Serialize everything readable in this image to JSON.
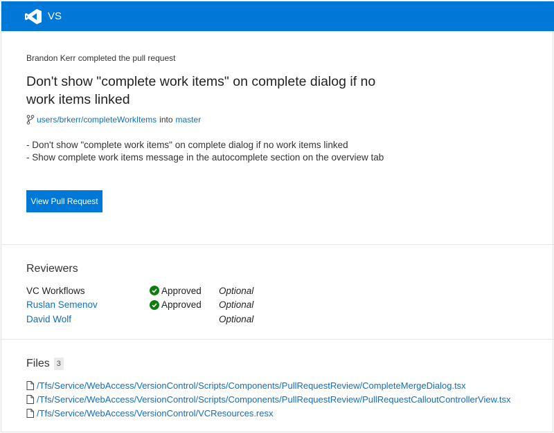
{
  "header": {
    "brand": "VS"
  },
  "pull_request": {
    "activity": "Brandon Kerr completed the pull request",
    "title": "Don't show \"complete work items\" on complete dialog if no work items linked",
    "source_branch": "users/brkerr/completeWorkItems",
    "into_text": "into",
    "target_branch": "master",
    "description_lines": [
      "- Don't show \"complete work items\" on complete dialog if no work items linked",
      "- Show complete work items message in the autocomplete section on the overview tab"
    ],
    "view_button_label": "View Pull Request"
  },
  "reviewers": {
    "heading": "Reviewers",
    "items": [
      {
        "name": "VC Workflows",
        "status": "Approved",
        "requirement": "Optional"
      },
      {
        "name": "Ruslan Semenov",
        "status": "Approved",
        "requirement": "Optional"
      },
      {
        "name": "David Wolf",
        "status": "",
        "requirement": "Optional"
      }
    ]
  },
  "files": {
    "heading": "Files",
    "count": "3",
    "items": [
      "/Tfs/Service/WebAccess/VersionControl/Scripts/Components/PullRequestReview/CompleteMergeDialog.tsx",
      "/Tfs/Service/WebAccess/VersionControl/Scripts/Components/PullRequestReview/PullRequestCalloutControllerView.tsx",
      "/Tfs/Service/WebAccess/VersionControl/VCResources.resx"
    ]
  },
  "colors": {
    "header_bg": "#0078d7",
    "link": "#106ebe",
    "approved": "#107c10",
    "button_bg": "#0078d7"
  }
}
